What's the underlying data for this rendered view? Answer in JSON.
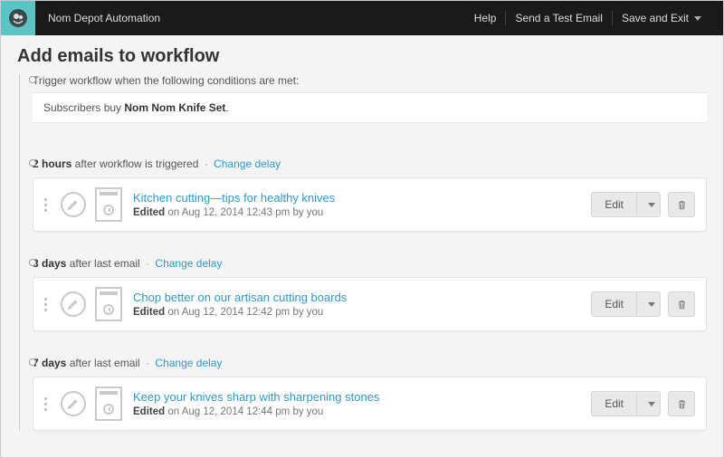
{
  "header": {
    "app_title": "Nom Depot Automation",
    "links": {
      "help": "Help",
      "send_test": "Send a Test Email",
      "save_exit": "Save and Exit"
    }
  },
  "page": {
    "title": "Add emails to workflow",
    "trigger_label": "Trigger workflow when the following conditions are met:",
    "condition_prefix": "Subscribers buy ",
    "condition_bold": "Nom Nom Knife Set",
    "condition_suffix": "."
  },
  "steps": [
    {
      "delay_bold": "2 hours",
      "delay_rest": " after workflow is triggered",
      "change_label": "Change delay",
      "email_title": "Kitchen cutting—tips for healthy knives",
      "meta_bold": "Edited",
      "meta_rest": " on Aug 12, 2014 12:43 pm by you",
      "edit_label": "Edit"
    },
    {
      "delay_bold": "3 days",
      "delay_rest": " after last email",
      "change_label": "Change delay",
      "email_title": "Chop better on our artisan cutting boards",
      "meta_bold": "Edited",
      "meta_rest": " on Aug 12, 2014 12:42 pm by you",
      "edit_label": "Edit"
    },
    {
      "delay_bold": "7 days",
      "delay_rest": " after last email",
      "change_label": "Change delay",
      "email_title": "Keep your knives sharp with sharpening stones",
      "meta_bold": "Edited",
      "meta_rest": " on Aug 12, 2014 12:44 pm by you",
      "edit_label": "Edit"
    }
  ]
}
